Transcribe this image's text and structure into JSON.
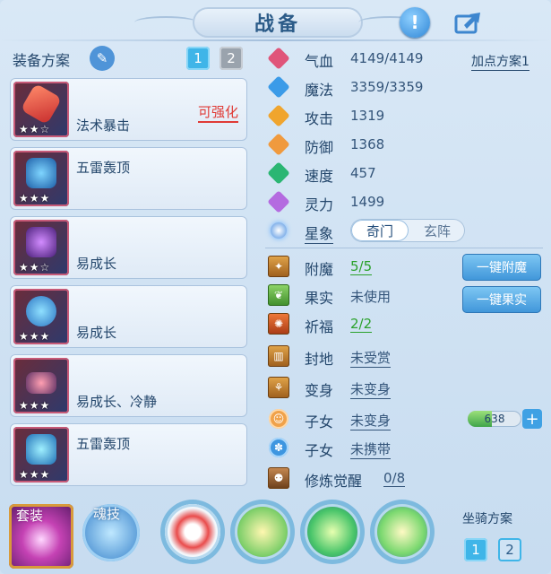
{
  "title": "战备",
  "equip_plan": {
    "label": "装备方案",
    "tabs": [
      "1",
      "2"
    ]
  },
  "equipment": [
    {
      "name": "法术暴击",
      "tag": "可强化",
      "stars": "★★☆"
    },
    {
      "name": "五雷轰顶",
      "tag": "",
      "stars": "★★★"
    },
    {
      "name": "易成长",
      "tag": "",
      "stars": "★★☆"
    },
    {
      "name": "易成长",
      "tag": "",
      "stars": "★★★"
    },
    {
      "name": "易成长、冷静",
      "tag": "",
      "stars": "★★★"
    },
    {
      "name": "五雷轰顶",
      "tag": "",
      "stars": "★★★"
    }
  ],
  "stats": [
    {
      "name": "气血",
      "value": "4149/4149",
      "color": "#e0557a",
      "icon": "heart-icon"
    },
    {
      "name": "魔法",
      "value": "3359/3359",
      "color": "#3b9be8",
      "icon": "mana-icon"
    },
    {
      "name": "攻击",
      "value": "1319",
      "color": "#f0a52e",
      "icon": "sword-icon"
    },
    {
      "name": "防御",
      "value": "1368",
      "color": "#f09a3e",
      "icon": "shield-icon"
    },
    {
      "name": "速度",
      "value": "457",
      "color": "#2bb673",
      "icon": "speed-icon"
    },
    {
      "name": "灵力",
      "value": "1499",
      "color": "#b46be0",
      "icon": "spirit-icon"
    }
  ],
  "add_point_plan": "加点方案1",
  "star_sign": {
    "label": "星象",
    "options": [
      "奇门",
      "玄阵"
    ]
  },
  "extras": [
    {
      "name": "附魔",
      "value": "5/5",
      "green": true
    },
    {
      "name": "果实",
      "value": "未使用",
      "green": false
    },
    {
      "name": "祈福",
      "value": "2/2",
      "green": true
    },
    {
      "name": "封地",
      "value": "未受赏",
      "green": false
    },
    {
      "name": "变身",
      "value": "未变身",
      "green": false
    },
    {
      "name": "子女",
      "value": "未变身",
      "green": false
    },
    {
      "name": "子女",
      "value": "未携带",
      "green": false
    },
    {
      "name": "修炼觉醒",
      "value": "0/8",
      "green": false
    }
  ],
  "buttons": {
    "enchant": "一键附魔",
    "fruit": "一键果实"
  },
  "child_bar": {
    "value": "638",
    "fill_fraction": 0.45
  },
  "bottom": {
    "suit_label": "套装",
    "soul_label": "魂技",
    "mount_plan": "坐骑方案",
    "mount_tabs": [
      "1",
      "2"
    ]
  }
}
